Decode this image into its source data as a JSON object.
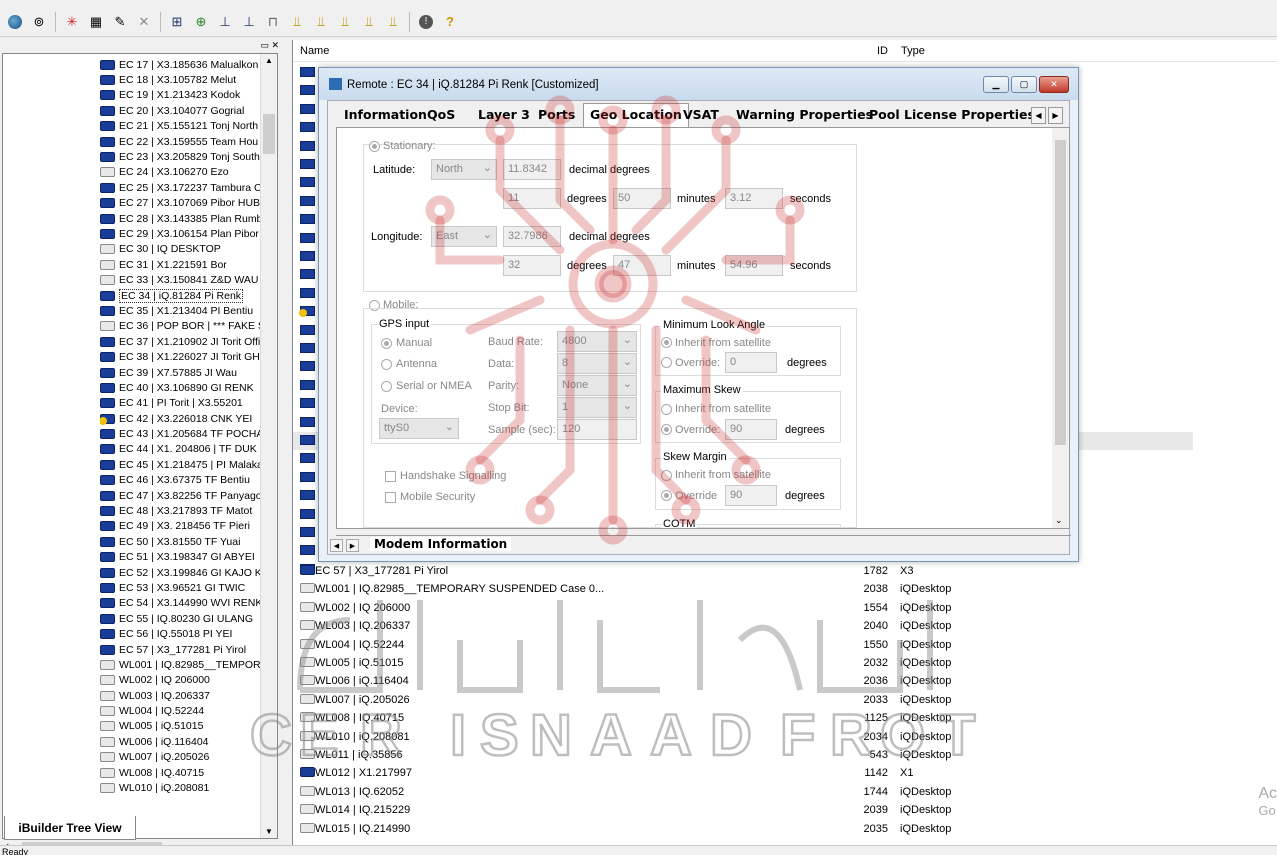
{
  "toolbar": {
    "icons": [
      "globe-icon",
      "binoculars-icon",
      "star-icon",
      "properties-icon",
      "edit-icon",
      "delete-icon",
      "network-icon",
      "add-network-icon",
      "remote-icon",
      "remote-add-icon",
      "sub-icon",
      "chart-icon",
      "chart2-icon",
      "chart3-icon",
      "chart4-icon",
      "chart5-icon",
      "alert-icon",
      "help-icon"
    ]
  },
  "tree": {
    "tab_label": "iBuilder Tree View",
    "selected": "EC 34 | iQ.81284 Pi Renk",
    "items": [
      {
        "label": "EC 17 | X3.185636 Malualkon",
        "icon": "modem"
      },
      {
        "label": "EC 18 | X3.105782 Melut",
        "icon": "modem"
      },
      {
        "label": "EC 19 | X1.213423 Kodok",
        "icon": "modem"
      },
      {
        "label": "EC 20 | X3.104077 Gogrial",
        "icon": "modem"
      },
      {
        "label": "EC 21 | X5.155121 Tonj North",
        "icon": "modem"
      },
      {
        "label": "EC 22 | X3.159555 Team Hou",
        "icon": "modem"
      },
      {
        "label": "EC 23 | X3.205829 Tonj South",
        "icon": "modem"
      },
      {
        "label": "EC 24 | X3.106270 Ezo",
        "icon": "gray"
      },
      {
        "label": "EC 25 | X3.172237 Tambura C",
        "icon": "modem"
      },
      {
        "label": "EC 27 | X3.107069 Pibor HUB",
        "icon": "modem"
      },
      {
        "label": "EC 28 | X3.143385 Plan Rumb",
        "icon": "modem"
      },
      {
        "label": "EC 29 | X3.106154 Plan Pibor",
        "icon": "modem"
      },
      {
        "label": "EC 30 | IQ DESKTOP",
        "icon": "gray"
      },
      {
        "label": "EC 31 | X1.221591 Bor",
        "icon": "gray"
      },
      {
        "label": "EC 33 | X3.150841 Z&D WAU",
        "icon": "gray"
      },
      {
        "label": "EC 34 | iQ.81284 Pi Renk",
        "icon": "modem"
      },
      {
        "label": "EC 35 | X1.213404 PI Bentiu",
        "icon": "modem"
      },
      {
        "label": "EC 36 | POP BOR | *** FAKE S",
        "icon": "gray"
      },
      {
        "label": "EC 37 | X1.210902 JI Torit Offi",
        "icon": "modem"
      },
      {
        "label": "EC 38 | X1.226027 JI Torit GH",
        "icon": "modem"
      },
      {
        "label": "EC 39 | X7.57885 JI Wau",
        "icon": "modem"
      },
      {
        "label": "EC 40 | X3.106890 GI RENK",
        "icon": "modem"
      },
      {
        "label": "EC 41 | PI Torit | X3.55201",
        "icon": "modem"
      },
      {
        "label": "EC 42 | X3.226018 CNK YEI",
        "icon": "warn"
      },
      {
        "label": "EC 43 | X1.205684 TF POCHA",
        "icon": "modem"
      },
      {
        "label": "EC 44 | X1. 204806 | TF DUK",
        "icon": "modem"
      },
      {
        "label": "EC 45 | X1.218475 | PI Malaka",
        "icon": "modem"
      },
      {
        "label": "EC 46 | X3.67375 TF Bentiu",
        "icon": "modem"
      },
      {
        "label": "EC 47 | X3.82256 TF Panyago",
        "icon": "modem"
      },
      {
        "label": "EC 48 | X3.217893 TF Matot",
        "icon": "modem"
      },
      {
        "label": "EC 49 | X3. 218456 TF Pieri",
        "icon": "modem"
      },
      {
        "label": "EC 50 | X3.81550 TF Yuai",
        "icon": "modem"
      },
      {
        "label": "EC 51 | X3.198347 GI ABYEI",
        "icon": "modem"
      },
      {
        "label": "EC 52 | X3.199846 GI KAJO K",
        "icon": "modem"
      },
      {
        "label": "EC 53 | X3.96521 GI TWIC",
        "icon": "modem"
      },
      {
        "label": "EC 54 | X3.144990 WVI RENK",
        "icon": "modem"
      },
      {
        "label": "EC 55 | IQ.80230 GI ULANG",
        "icon": "modem"
      },
      {
        "label": "EC 56 | IQ.55018 PI YEI",
        "icon": "modem"
      },
      {
        "label": "EC 57 | X3_177281 Pi Yirol",
        "icon": "modem"
      },
      {
        "label": "WL001 | IQ.82985__TEMPOR",
        "icon": "gray"
      },
      {
        "label": "WL002 | IQ 206000",
        "icon": "gray"
      },
      {
        "label": "WL003 | IQ.206337",
        "icon": "gray"
      },
      {
        "label": "WL004 | IQ.52244",
        "icon": "gray"
      },
      {
        "label": "WL005 | iQ.51015",
        "icon": "gray"
      },
      {
        "label": "WL006 | iQ.116404",
        "icon": "gray"
      },
      {
        "label": "WL007 | iQ.205026",
        "icon": "gray"
      },
      {
        "label": "WL008 | IQ.40715",
        "icon": "gray"
      },
      {
        "label": "WL010 | iQ.208081",
        "icon": "gray"
      }
    ]
  },
  "list": {
    "col_name": "Name",
    "col_id": "ID",
    "col_type": "Type",
    "rows": [
      {
        "name": "EC 57 | X3_177281 Pi Yirol",
        "id": "1782",
        "type": "X3",
        "icon": "modem"
      },
      {
        "name": "WL001 | IQ.82985__TEMPORARY SUSPENDED Case 0...",
        "id": "2038",
        "type": "iQDesktop",
        "icon": "gray"
      },
      {
        "name": "WL002 | IQ 206000",
        "id": "1554",
        "type": "iQDesktop",
        "icon": "gray"
      },
      {
        "name": "WL003 | IQ.206337",
        "id": "2040",
        "type": "iQDesktop",
        "icon": "gray"
      },
      {
        "name": "WL004 | IQ.52244",
        "id": "1550",
        "type": "iQDesktop",
        "icon": "gray"
      },
      {
        "name": "WL005 | iQ.51015",
        "id": "2032",
        "type": "iQDesktop",
        "icon": "gray"
      },
      {
        "name": "WL006 | iQ.116404",
        "id": "2036",
        "type": "iQDesktop",
        "icon": "gray"
      },
      {
        "name": "WL007 | iQ.205026",
        "id": "2033",
        "type": "iQDesktop",
        "icon": "gray"
      },
      {
        "name": "WL008 | IQ.40715",
        "id": "1125",
        "type": "iQDesktop",
        "icon": "gray"
      },
      {
        "name": "WL010 | iQ.208081",
        "id": "2034",
        "type": "iQDesktop",
        "icon": "gray"
      },
      {
        "name": "WL011 | iQ.35856",
        "id": "543",
        "type": "iQDesktop",
        "icon": "gray"
      },
      {
        "name": "WL012 | X1.217997",
        "id": "1142",
        "type": "X1",
        "icon": "modem"
      },
      {
        "name": "WL013 | IQ.62052",
        "id": "1744",
        "type": "iQDesktop",
        "icon": "gray"
      },
      {
        "name": "WL014 | IQ.215229",
        "id": "2039",
        "type": "iQDesktop",
        "icon": "gray"
      },
      {
        "name": "WL015 | IQ.214990",
        "id": "2035",
        "type": "iQDesktop",
        "icon": "gray"
      }
    ]
  },
  "dialog": {
    "title": "Remote : EC 34 | iQ.81284 Pi Renk [Customized]",
    "tabs": [
      "Information",
      "QoS",
      "Layer 3",
      "Ports",
      "Geo Location",
      "VSAT",
      "Warning Properties",
      "Pool License Properties"
    ],
    "active_tab": "Geo Location",
    "bottom_tab": "Modem Information",
    "stationary": {
      "label": "Stationary:",
      "latitude_label": "Latitude:",
      "latitude_dir": "North",
      "latitude_decimal": "11.8342",
      "decimal_unit": "decimal degrees",
      "latitude_deg": "11",
      "latitude_min": "50",
      "latitude_sec": "3.12",
      "degrees_unit": "degrees",
      "minutes_unit": "minutes",
      "seconds_unit": "seconds",
      "longitude_label": "Longitude:",
      "longitude_dir": "East",
      "longitude_decimal": "32.7986",
      "longitude_deg": "32",
      "longitude_min": "47",
      "longitude_sec": "54.96"
    },
    "mobile": {
      "label": "Mobile:",
      "gps_input": "GPS input",
      "manual": "Manual",
      "antenna": "Antenna",
      "serial": "Serial or NMEA",
      "device_label": "Device:",
      "device_value": "ttyS0",
      "baud_label": "Baud Rate:",
      "baud_value": "4800",
      "data_label": "Data:",
      "data_value": "8",
      "parity_label": "Parity:",
      "parity_value": "None",
      "stop_label": "Stop Bit:",
      "stop_value": "1",
      "sample_label": "Sample (sec):",
      "sample_value": "120",
      "handshake": "Handshake Signalling",
      "mobile_security": "Mobile Security",
      "min_look_angle": "Minimum Look Angle",
      "max_skew": "Maximum Skew",
      "skew_margin": "Skew Margin",
      "cotm": "COTM",
      "inherit": "Inherit from satellite",
      "override": "Override:",
      "override_plain": "Override",
      "min_look_value": "0",
      "max_skew_value": "90",
      "skew_margin_value": "90",
      "degrees_unit": "degrees"
    }
  },
  "status": {
    "text": "Ready"
  },
  "activate": {
    "line1": "Ac",
    "line2": "Go"
  },
  "watermark": {
    "arabic": "الجبهة الإسنادية",
    "english": "CHEER ISNAAD FRONT"
  }
}
